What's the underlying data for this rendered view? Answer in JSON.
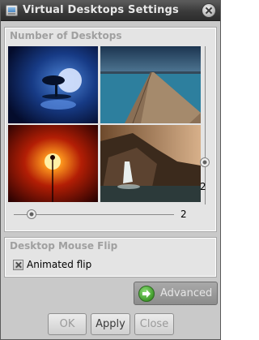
{
  "window": {
    "title": "Virtual Desktops Settings"
  },
  "desktops_group": {
    "title": "Number of Desktops",
    "vertical_slider_value": "2",
    "horizontal_slider_value": "2"
  },
  "mouse_flip_group": {
    "title": "Desktop Mouse Flip",
    "animated_flip_label": "Animated flip",
    "animated_flip_checked": true
  },
  "buttons": {
    "advanced": "Advanced",
    "ok": "OK",
    "apply": "Apply",
    "close": "Close"
  },
  "icons": {
    "window_icon": "virtual-desktops-icon",
    "close": "close-icon",
    "advanced": "arrow-right-icon"
  },
  "colors": {
    "titlebar": "#3a3a3a",
    "window_bg": "#c9c9c9",
    "group_bg": "#e4e4e4",
    "accent_green": "#3f9a2a"
  }
}
